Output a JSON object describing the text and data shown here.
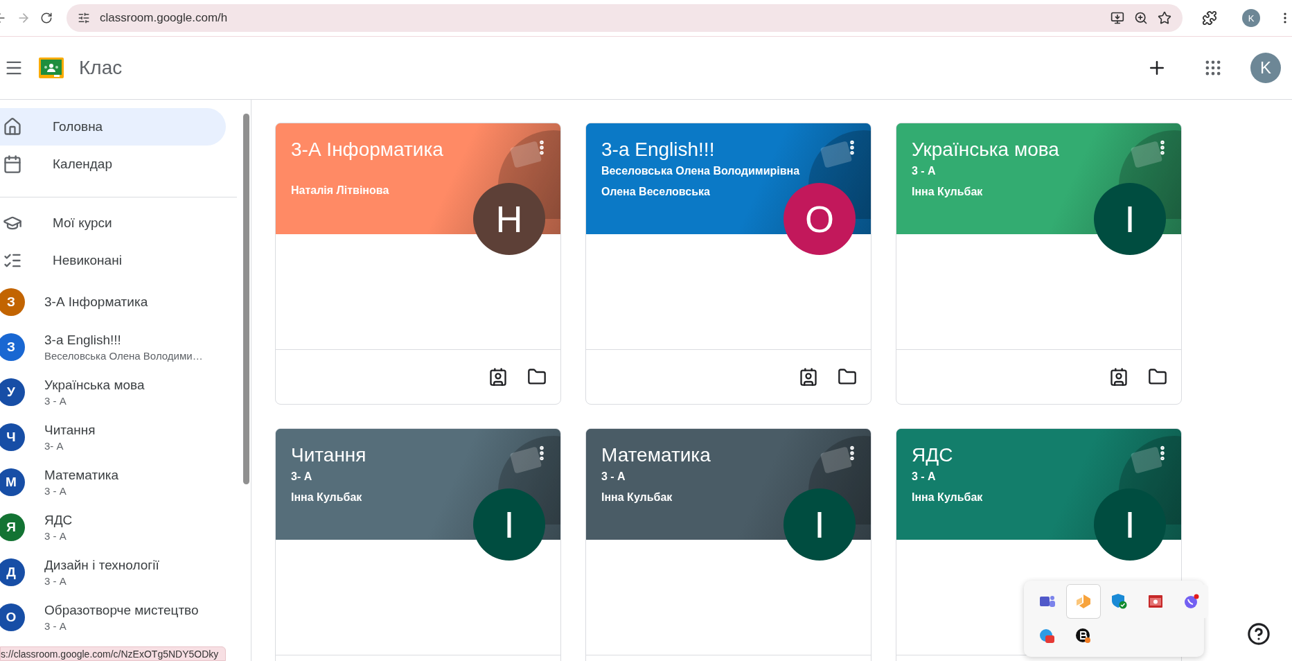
{
  "browser": {
    "url": "classroom.google.com/h",
    "profile_letter": "K"
  },
  "header": {
    "title": "Клас",
    "avatar_letter": "K"
  },
  "sidebar": {
    "nav": [
      {
        "kind": "home",
        "label": "Головна",
        "selected": true
      },
      {
        "kind": "calendar",
        "label": "Календар",
        "selected": false
      },
      {
        "kind": "divider"
      },
      {
        "kind": "courses",
        "label": "Мої курси",
        "selected": false
      },
      {
        "kind": "todo",
        "label": "Невиконані",
        "selected": false
      }
    ],
    "courses": [
      {
        "letter": "З",
        "name": "3-А Інформатика",
        "color": "#c26401",
        "selected": false
      },
      {
        "letter": "З",
        "name": "3-а English!!!",
        "subtitle": "Веселовська Олена Володими…",
        "color": "#1967d2",
        "selected": false
      },
      {
        "letter": "У",
        "name": "Українська мова",
        "subtitle": "3 - А",
        "color": "#174ea6",
        "selected": false
      },
      {
        "letter": "Ч",
        "name": "Читання",
        "subtitle": "3- А",
        "color": "#174ea6",
        "selected": false
      },
      {
        "letter": "М",
        "name": "Математика",
        "subtitle": "3 - А",
        "color": "#174ea6",
        "selected": false
      },
      {
        "letter": "Я",
        "name": "ЯДС",
        "subtitle": "3 - А",
        "color": "#137333",
        "selected": false
      },
      {
        "letter": "Д",
        "name": "Дизайн і технології",
        "subtitle": "3 - А",
        "color": "#174ea6",
        "selected": false
      },
      {
        "letter": "О",
        "name": "Образотворче мистецтво",
        "subtitle": "3 - А",
        "color": "#174ea6",
        "selected": false
      }
    ]
  },
  "cards": [
    {
      "title": "3-А Інформатика",
      "teacher": "Наталія Літвінова",
      "avatar": {
        "letter": "Н",
        "color": "#5d4037"
      },
      "color": "#ff8a65"
    },
    {
      "title": "3-а English!!!",
      "subtitle": "Веселовська Олена Володимирівна",
      "teacher": "Олена Веселовська",
      "avatar": {
        "letter": "О",
        "color": "#c2185b"
      },
      "color": "#0b79c6"
    },
    {
      "title": "Українська мова",
      "subtitle": "3 - А",
      "teacher": "Інна Кульбак",
      "avatar": {
        "letter": "І",
        "color": "#004d40"
      },
      "color": "#33ac71"
    },
    {
      "title": "Читання",
      "subtitle": "3- А",
      "teacher": "Інна Кульбак",
      "avatar": {
        "letter": "І",
        "color": "#004d40"
      },
      "color": "#566e7a"
    },
    {
      "title": "Математика",
      "subtitle": "3 - А",
      "teacher": "Інна Кульбак",
      "avatar": {
        "letter": "І",
        "color": "#004d40"
      },
      "color": "#4a5c66"
    },
    {
      "title": "ЯДС",
      "subtitle": "3 - А",
      "teacher": "Інна Кульбак",
      "avatar": {
        "letter": "І",
        "color": "#004d40"
      },
      "color": "#137e6b"
    }
  ],
  "status_url": "s://classroom.google.com/c/NzExOTg5NDY5ODky",
  "tray": {
    "icons": [
      {
        "kind": "teams",
        "selected": false
      },
      {
        "kind": "orange",
        "selected": true
      },
      {
        "kind": "shield",
        "selected": false
      },
      {
        "kind": "camera",
        "selected": false
      },
      {
        "kind": "viber",
        "selected": false
      },
      {
        "kind": "blue",
        "selected": false
      },
      {
        "kind": "b",
        "selected": false
      }
    ]
  }
}
